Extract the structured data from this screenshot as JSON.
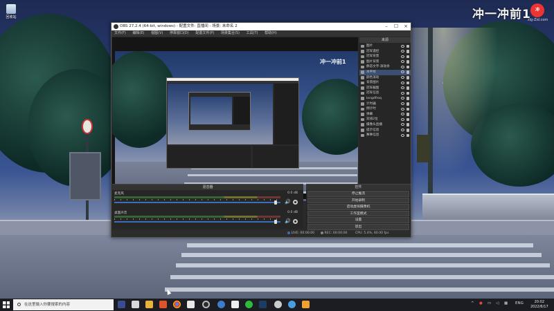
{
  "desktop": {
    "icon_label": "回收站",
    "watermark": "冲一冲前1",
    "watermark_badge": "冲",
    "watermark_sub": "zlg-Zid.com"
  },
  "obs": {
    "title": "OBS 27.2.4 (64-bit, windows) - 配置文件: 直播间 - 场景: 未命名 2",
    "menu": [
      "文件(F)",
      "编辑(E)",
      "视图(V)",
      "停靠窗口(D)",
      "配置文件(P)",
      "场景集合(S)",
      "工具(T)",
      "帮助(H)"
    ],
    "preview_watermark": "冲一冲前1",
    "sources_title": "来源",
    "sources": [
      "图片",
      "冠军遥控",
      "冠军背景",
      "图片背景",
      "静态文字-滚动条",
      "水平纹",
      "颜色滚动",
      "背景图片",
      "冠军截图",
      "冠军信息",
      "longdfroq",
      "计时器",
      "倒计时",
      "弹幕",
      "双排2位",
      "摄像头直播",
      "提示信息",
      "赛事信息"
    ],
    "selected_source_index": 5,
    "source_tools": [
      "+",
      "−",
      "⚙",
      "∧",
      "∨"
    ],
    "mixer_title": "混音器",
    "mixer_tracks": [
      {
        "name": "麦克风",
        "db": "0.0 dB",
        "level": 0.98
      },
      {
        "name": "桌面声音",
        "db": "0.0 dB",
        "level": 0.98
      }
    ],
    "controls_title": "控件",
    "controls": [
      "停止推流",
      "开始录制",
      "启动虚拟摄像机",
      "工作室模式",
      "设置",
      "退出"
    ],
    "status": {
      "live": "LIVE: 00:00:00",
      "rec": "REC: 00:00:00",
      "cpu": "CPU: 5.4%, 60.00 fps"
    }
  },
  "taskbar": {
    "search_placeholder": "在这里输入你要搜索的内容",
    "language": "ENG",
    "time": "20:02",
    "date": "2022/6/17"
  }
}
